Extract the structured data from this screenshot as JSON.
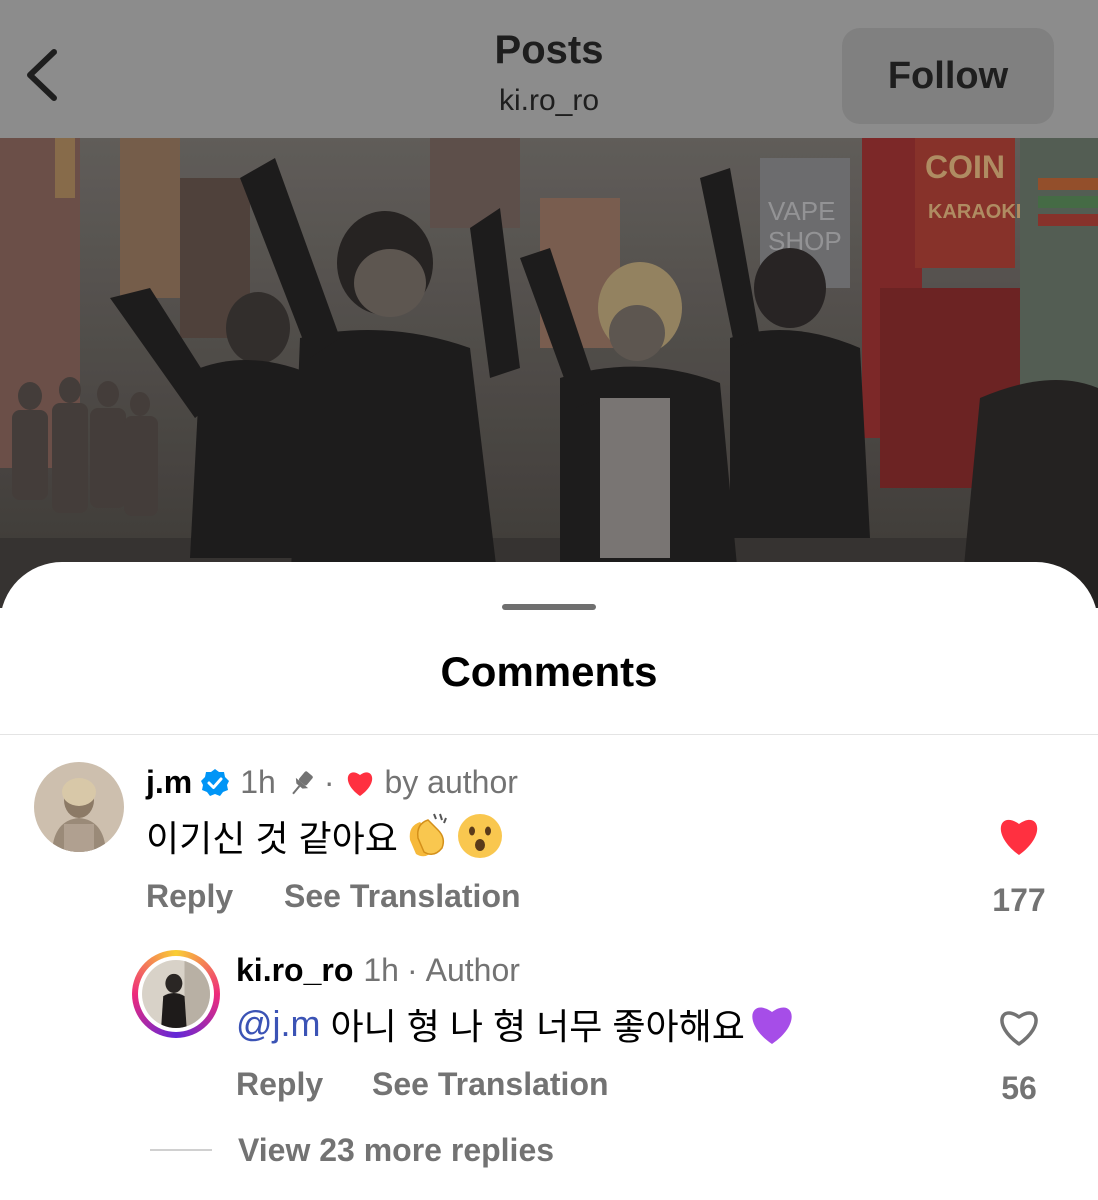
{
  "header": {
    "title": "Posts",
    "username": "ki.ro_ro",
    "follow_label": "Follow"
  },
  "comments_sheet": {
    "title": "Comments"
  },
  "comment": {
    "username": "j.m",
    "verified": true,
    "time": "1h",
    "pinned": true,
    "dot": "·",
    "liked_by_author_label": "by author",
    "text": "이기신 것 같아요",
    "emojis": [
      "clapping-hands",
      "surprised-face"
    ],
    "reply_label": "Reply",
    "translate_label": "See Translation",
    "like_count": "177",
    "liked": true
  },
  "reply": {
    "username": "ki.ro_ro",
    "time": "1h",
    "dot": "·",
    "author_label": "Author",
    "mention": "@j.m",
    "text": "아니 형 나 형 너무 좋아해요",
    "emojis": [
      "purple-heart"
    ],
    "reply_label": "Reply",
    "translate_label": "See Translation",
    "like_count": "56",
    "liked": false
  },
  "view_more_replies": "View 23 more replies",
  "colors": {
    "like_red": "#ff3040",
    "verified_blue": "#0095f6",
    "mention_blue": "#3b53b5",
    "muted_text": "#737373",
    "story_ring": [
      "#f9ce34",
      "#ee2a7b",
      "#6228d7"
    ]
  }
}
